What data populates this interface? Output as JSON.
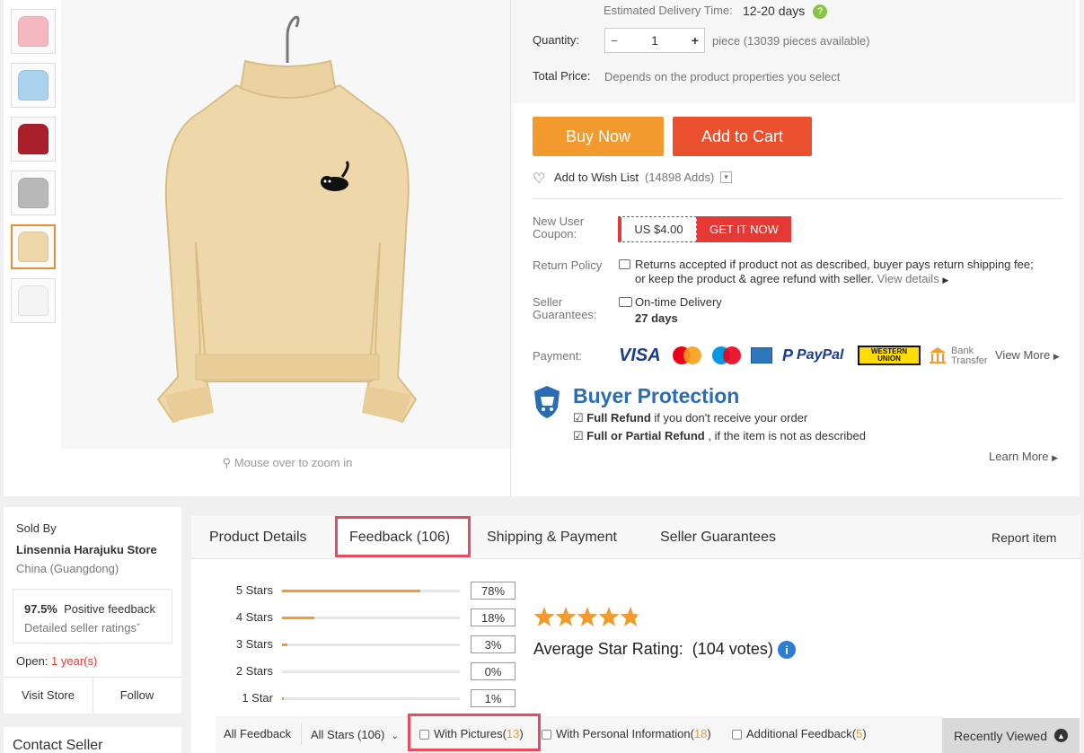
{
  "delivery": {
    "label": "Estimated Delivery Time:",
    "value": "12-20 days"
  },
  "quantity": {
    "label": "Quantity:",
    "value": "1",
    "minus": "−",
    "plus": "+",
    "note": "piece (13039 pieces available)"
  },
  "total_price": {
    "label": "Total Price:",
    "value": "Depends on the product properties you select"
  },
  "buttons": {
    "buy_now": "Buy Now",
    "add_to_cart": "Add to Cart"
  },
  "wishlist": {
    "label": "Add to Wish List",
    "count": "(14898 Adds)"
  },
  "coupon": {
    "label_line1": "New User",
    "label_line2": "Coupon:",
    "amount": "US $4.00",
    "action": "GET IT NOW"
  },
  "return_policy": {
    "label": "Return Policy",
    "line1": "Returns accepted if product not as described, buyer pays return shipping fee;",
    "line2": "or keep the product & agree refund with seller.",
    "link": "View details"
  },
  "seller_guarantees": {
    "label_line1": "Seller",
    "label_line2": "Guarantees:",
    "title": "On-time Delivery",
    "days": "27 days"
  },
  "payment": {
    "label": "Payment:",
    "visa": "VISA",
    "mastercard": "MasterCard",
    "maestro": "Maestro",
    "paypal": "PayPal",
    "western_union_1": "WESTERN",
    "western_union_2": "UNION",
    "bank_1": "Bank",
    "bank_2": "Transfer",
    "view_more": "View More"
  },
  "protection": {
    "title": "Buyer Protection",
    "item1_bold": "Full Refund",
    "item1_rest": " if you don't receive your order",
    "item2_bold": "Full or Partial Refund",
    "item2_rest": " , if the item is not as described",
    "learn_more": "Learn More"
  },
  "zoom_hint": "Mouse over to zoom in",
  "seller": {
    "sold_by": "Sold By",
    "store": "Linsennia Harajuku Store",
    "location": "China (Guangdong)",
    "positive": "97.5%",
    "positive_label": "Positive feedback",
    "detailed": "Detailed seller ratings",
    "open_label": "Open:",
    "open_value": "1 year(s)",
    "visit": "Visit Store",
    "follow": "Follow",
    "contact": "Contact Seller"
  },
  "tabs": {
    "details": "Product Details",
    "feedback": "Feedback (106)",
    "shipping": "Shipping & Payment",
    "guarantees": "Seller Guarantees",
    "report": "Report item"
  },
  "ratings": [
    {
      "name": "5 Stars",
      "pct": "78%",
      "value": 0.78
    },
    {
      "name": "4 Stars",
      "pct": "18%",
      "value": 0.18
    },
    {
      "name": "3 Stars",
      "pct": "3%",
      "value": 0.03
    },
    {
      "name": "2 Stars",
      "pct": "0%",
      "value": 0.0
    },
    {
      "name": "1 Star",
      "pct": "1%",
      "value": 0.01
    }
  ],
  "average": {
    "label": "Average Star Rating:",
    "votes": "(104 votes)",
    "stars": 4.8
  },
  "filters": {
    "all": "All Feedback",
    "all_stars": "All Stars (106)",
    "with_pictures": "With Pictures",
    "with_pictures_count": "13",
    "personal": "With Personal Information",
    "personal_count": "18",
    "additional": "Additional Feedback",
    "additional_count": "5"
  },
  "recently_viewed": "Recently Viewed",
  "colors": {
    "orange": "#f39a2f",
    "red": "#ea4f2e",
    "highlight": "#e84a5f",
    "product": "#eed7a8"
  },
  "thumbnails": [
    {
      "color": "#f5b8c0",
      "name": "pink"
    },
    {
      "color": "#a9d2ec",
      "name": "light blue"
    },
    {
      "color": "#a8202c",
      "name": "red"
    },
    {
      "color": "#b8b8b8",
      "name": "grey"
    },
    {
      "color": "#eed7a8",
      "name": "beige"
    },
    {
      "color": "#f4f4f4",
      "name": "white"
    }
  ]
}
